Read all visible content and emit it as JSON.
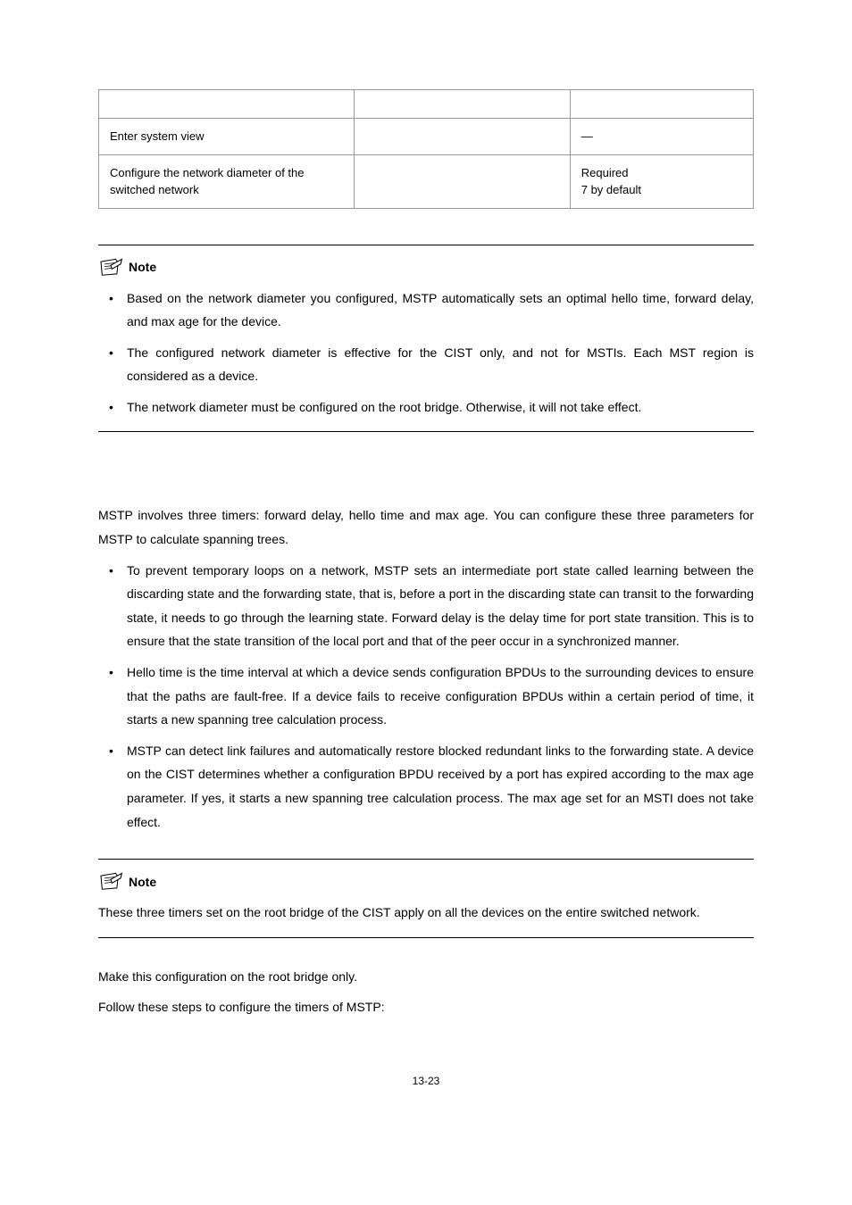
{
  "table": {
    "headers": [
      "",
      "",
      ""
    ],
    "rows": [
      {
        "c1": "Enter system view",
        "c2": "",
        "c3": "—"
      },
      {
        "c1": "Configure the network diameter of the switched network",
        "c2": "",
        "c3a": "Required",
        "c3b": "7 by default"
      }
    ]
  },
  "note1": {
    "label": "Note",
    "items": [
      "Based on the network diameter you configured, MSTP automatically sets an optimal hello time, forward delay, and max age for the device.",
      "The configured network diameter is effective for the CIST only, and not for MSTIs. Each MST region is considered as a device.",
      "The network diameter must be configured on the root bridge. Otherwise, it will not take effect."
    ]
  },
  "section": {
    "intro": "MSTP involves three timers: forward delay, hello time and max age. You can configure these three parameters for MSTP to calculate spanning trees.",
    "items": [
      "To prevent temporary loops on a network, MSTP sets an intermediate port state called learning between the discarding state and the forwarding state, that is, before a port in the discarding state can transit to the forwarding state, it needs to go through the learning state. Forward delay is the delay time for port state transition. This is to ensure that the state transition of the local port and that of the peer occur in a synchronized manner.",
      "Hello time is the time interval at which a device sends configuration BPDUs to the surrounding devices to ensure that the paths are fault-free. If a device fails to receive configuration BPDUs within a certain period of time, it starts a new spanning tree calculation process.",
      "MSTP can detect link failures and automatically restore blocked redundant links to the forwarding state. A device on the CIST determines whether a configuration BPDU received by a port has expired according to the max age parameter. If yes, it starts a new spanning tree calculation process. The max age set for an MSTI does not take effect."
    ]
  },
  "note2": {
    "label": "Note",
    "text": "These three timers set on the root bridge of the CIST apply on all the devices on the entire switched network."
  },
  "closing": {
    "line1": "Make this configuration on the root bridge only.",
    "line2": "Follow these steps to configure the timers of MSTP:"
  },
  "page_number": "13-23"
}
